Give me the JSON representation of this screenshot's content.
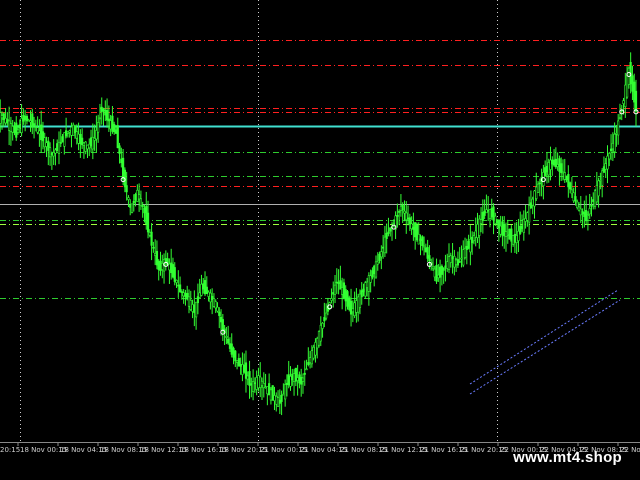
{
  "chart": {
    "background": "#000000",
    "candle_color": "#33ff33",
    "x_axis_labels": [
      "20:15",
      "18 Nov 00:15",
      "18 Nov 04:15",
      "18 Nov 08:15",
      "18 Nov 12:15",
      "18 Nov 16:15",
      "18 Nov 20:15",
      "21 Nov 00:15",
      "21 Nov 04:15",
      "21 Nov 08:15",
      "21 Nov 12:15",
      "21 Nov 16:15",
      "21 Nov 20:15",
      "22 Nov 00:15",
      "22 Nov 04:15",
      "22 Nov 08:15",
      "22 Nov"
    ]
  },
  "watermark": "www.mt4.shop",
  "chart_data": {
    "type": "line",
    "title": "",
    "series": [
      {
        "values": [
          355,
          350,
          345,
          354,
          352,
          347,
          340,
          332,
          338,
          345,
          348,
          340,
          337,
          342,
          360,
          352,
          345,
          320,
          300,
          310,
          298,
          280,
          265,
          270,
          262,
          252,
          248,
          240,
          255,
          250,
          244,
          230,
          218,
          210,
          205,
          196,
          200,
          195,
          190,
          186,
          198,
          202,
          198,
          210,
          220,
          233,
          245,
          258,
          250,
          240,
          246,
          255,
          262,
          272,
          285,
          292,
          302,
          294,
          286,
          280,
          270,
          260,
          265,
          272,
          268,
          276,
          282,
          292,
          300,
          296,
          288,
          285,
          282,
          290,
          300,
          312,
          320,
          328,
          326,
          320,
          310,
          300,
          295,
          306,
          318,
          330,
          342,
          360,
          382,
          360
        ]
      }
    ]
  }
}
